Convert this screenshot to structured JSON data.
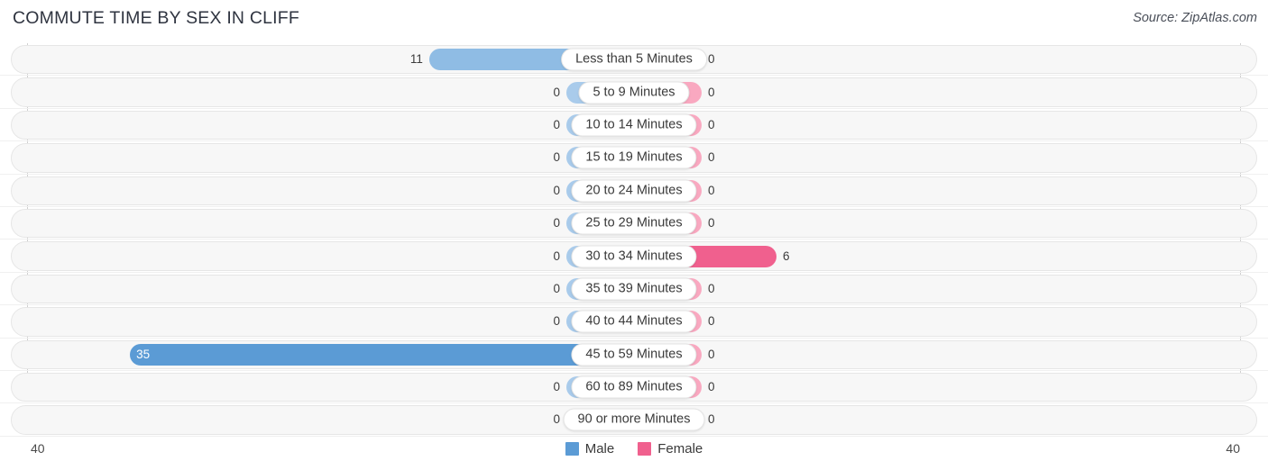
{
  "header": {
    "title": "COMMUTE TIME BY SEX IN CLIFF",
    "source": "Source: ZipAtlas.com"
  },
  "legend": {
    "male_label": "Male",
    "female_label": "Female",
    "male_color": "#5b9bd5",
    "female_color": "#f0608e"
  },
  "axis": {
    "left_bound": "40",
    "right_bound": "40"
  },
  "chart_data": {
    "type": "bar",
    "title": "COMMUTE TIME BY SEX IN CLIFF",
    "subtitle": "Source: ZipAtlas.com",
    "orientation": "horizontal-diverging",
    "xlabel": "",
    "ylabel": "",
    "xlim": [
      40,
      40
    ],
    "grid": false,
    "legend_position": "bottom-center",
    "categories": [
      "Less than 5 Minutes",
      "5 to 9 Minutes",
      "10 to 14 Minutes",
      "15 to 19 Minutes",
      "20 to 24 Minutes",
      "25 to 29 Minutes",
      "30 to 34 Minutes",
      "35 to 39 Minutes",
      "40 to 44 Minutes",
      "45 to 59 Minutes",
      "60 to 89 Minutes",
      "90 or more Minutes"
    ],
    "series": [
      {
        "name": "Male",
        "values": [
          11,
          0,
          0,
          0,
          0,
          0,
          0,
          0,
          0,
          35,
          0,
          0
        ]
      },
      {
        "name": "Female",
        "values": [
          0,
          0,
          0,
          0,
          0,
          0,
          6,
          0,
          0,
          0,
          0,
          0
        ]
      }
    ],
    "male_labels": [
      "11",
      "0",
      "0",
      "0",
      "0",
      "0",
      "0",
      "0",
      "0",
      "35",
      "0",
      "0"
    ],
    "female_labels": [
      "0",
      "0",
      "0",
      "0",
      "0",
      "0",
      "6",
      "0",
      "0",
      "0",
      "0",
      "0"
    ]
  }
}
